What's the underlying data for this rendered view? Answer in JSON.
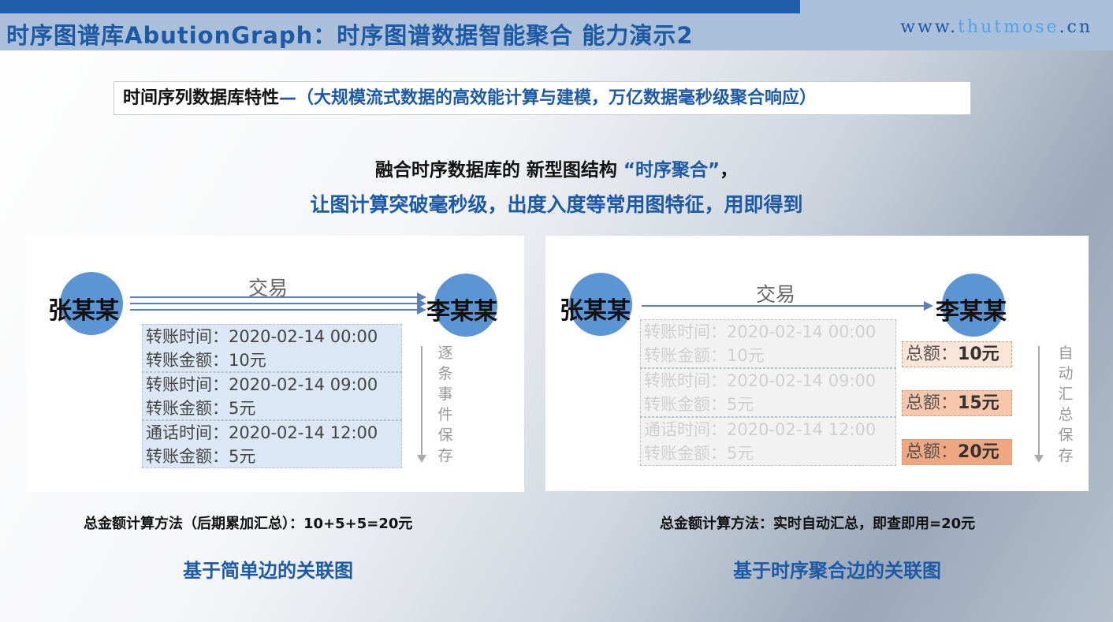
{
  "header": {
    "title": "时序图谱库AbutionGraph：时序图谱数据智能聚合 能力演示2",
    "site_prefix": "www.",
    "site_highlight": "thutmose",
    "site_suffix": ".cn"
  },
  "feature": {
    "key": "时间序列数据库特性",
    "desc": "—（大规模流式数据的高效能计算与建模，万亿数据毫秒级聚合响应）"
  },
  "headline": {
    "line1_pre": "融合时序数据库的 新型图结构 ",
    "line1_highlight": "“时序聚合”",
    "line1_post": "，",
    "line2": "让图计算突破毫秒级，出度入度等常用图特征，用即得到"
  },
  "left": {
    "from": "张某某",
    "to": "李某某",
    "edge": "交易",
    "records": [
      [
        "转账时间：2020-02-14 00:00",
        "转账金额：10元"
      ],
      [
        "转账时间：2020-02-14 09:00",
        "转账金额：5元"
      ],
      [
        "通话时间：2020-02-14 12:00",
        "转账金额：5元"
      ]
    ],
    "side": "逐条事件保存",
    "caption": "总金额计算方法（后期累加汇总）：10+5+5=20元",
    "subtitle": "基于简单边的关联图"
  },
  "right": {
    "from": "张某某",
    "to": "李某某",
    "edge": "交易",
    "records": [
      [
        "转账时间：2020-02-14 00:00",
        "转账金额：10元"
      ],
      [
        "转账时间：2020-02-14 09:00",
        "转账金额：5元"
      ],
      [
        "通话时间：2020-02-14 12:00",
        "转账金额：5元"
      ]
    ],
    "totals": [
      {
        "label": "总额：",
        "value": "10元"
      },
      {
        "label": "总额：",
        "value": "15元"
      },
      {
        "label": "总额：",
        "value": "20元"
      }
    ],
    "side": "自动汇总保存",
    "caption": "总金额计算方法：实时自动汇总，即查即用=20元",
    "subtitle": "基于时序聚合边的关联图"
  },
  "colors": {
    "brand_blue": "#1c5aa6",
    "node_blue": "#5b95d4",
    "record_blue": "#dbe7f4"
  }
}
